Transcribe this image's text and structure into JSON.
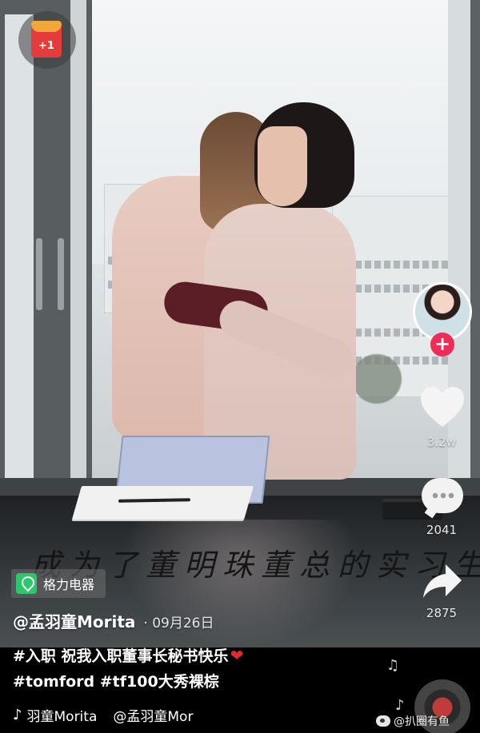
{
  "video": {
    "handwritten_caption": "成为了董明珠董总的实习生"
  },
  "red_packet": {
    "badge": "+1"
  },
  "side_actions": {
    "likes": "3.2w",
    "comments": "2041",
    "shares": "2875"
  },
  "location": {
    "label": "格力电器"
  },
  "post": {
    "author": "@孟羽童Morita",
    "date": "· 09月26日",
    "line1_tag": "#入职",
    "line1_text": "祝我入职董事长秘书快乐",
    "line1_emoji": "❤",
    "line2_tags": "#tomford #tf100大秀裸棕"
  },
  "music": {
    "left": "羽童Morita",
    "right": "@孟羽童Mor"
  },
  "watermark": {
    "text": "@扒圈有鱼"
  },
  "colors": {
    "follow": "#ef2c55",
    "location_icon": "#2cc76a",
    "heart_emoji": "#e32a2a"
  }
}
